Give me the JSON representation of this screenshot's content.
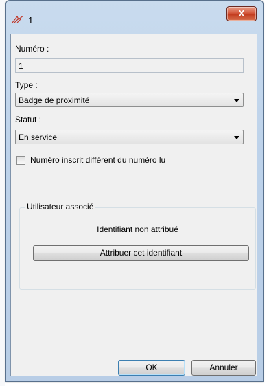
{
  "window": {
    "title": "1",
    "close_label": "X"
  },
  "form": {
    "numero_label": "Numéro :",
    "numero_value": "1",
    "type_label": "Type :",
    "type_value": "Badge de proximité",
    "statut_label": "Statut :",
    "statut_value": "En service",
    "checkbox_label": "Numéro inscrit différent du numéro lu",
    "checkbox_checked": false
  },
  "user_group": {
    "legend": "Utilisateur associé",
    "status_text": "Identifiant non attribué",
    "assign_button": "Attribuer cet identifiant"
  },
  "buttons": {
    "ok": "OK",
    "cancel": "Annuler"
  }
}
